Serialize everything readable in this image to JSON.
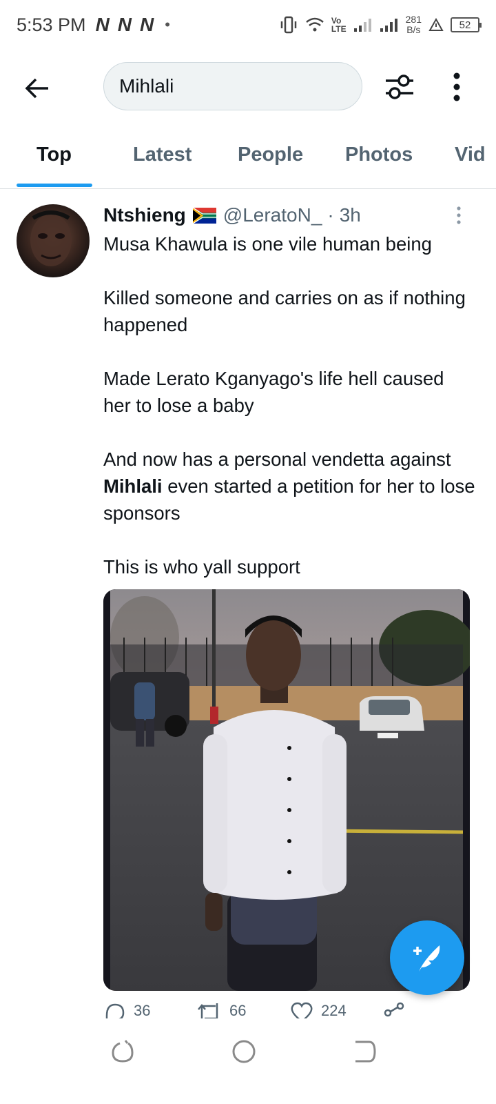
{
  "status_bar": {
    "time": "5:53 PM",
    "notification_icons": [
      "N",
      "N",
      "N"
    ],
    "dot": "•",
    "volte_top": "Vo",
    "volte_bottom": "LTE",
    "speed_value": "281",
    "speed_unit": "B/s",
    "battery": "52"
  },
  "search": {
    "query": "Mihlali"
  },
  "tabs": [
    {
      "label": "Top",
      "active": true
    },
    {
      "label": "Latest",
      "active": false
    },
    {
      "label": "People",
      "active": false
    },
    {
      "label": "Photos",
      "active": false
    },
    {
      "label": "Vid",
      "active": false
    }
  ],
  "tweet": {
    "display_name": "Ntshieng",
    "handle": "@LeratoN_",
    "separator": "·",
    "time": "3h",
    "paragraphs": [
      "Musa Khawula is one vile human being",
      "Killed someone and carries on as if nothing happened",
      "Made Lerato Kganyago's life hell caused her to lose a baby"
    ],
    "para4_before": "And now has a personal vendetta against ",
    "para4_highlight": "Mihlali",
    "para4_after": " even started a petition for her to lose sponsors",
    "para5": "This is who yall support",
    "actions": {
      "reply_count": "36",
      "retweet_count": "66",
      "like_count": "224"
    }
  },
  "colors": {
    "accent": "#1d9bf0",
    "text_primary": "#0f1419",
    "text_secondary": "#536471"
  },
  "icons": [
    "back-arrow-icon",
    "filter-sliders-icon",
    "more-vertical-icon",
    "flag-south-africa-icon",
    "reply-icon",
    "retweet-icon",
    "like-icon",
    "share-icon",
    "compose-feather-icon",
    "recents-icon",
    "home-circle-icon",
    "back-nav-icon"
  ]
}
